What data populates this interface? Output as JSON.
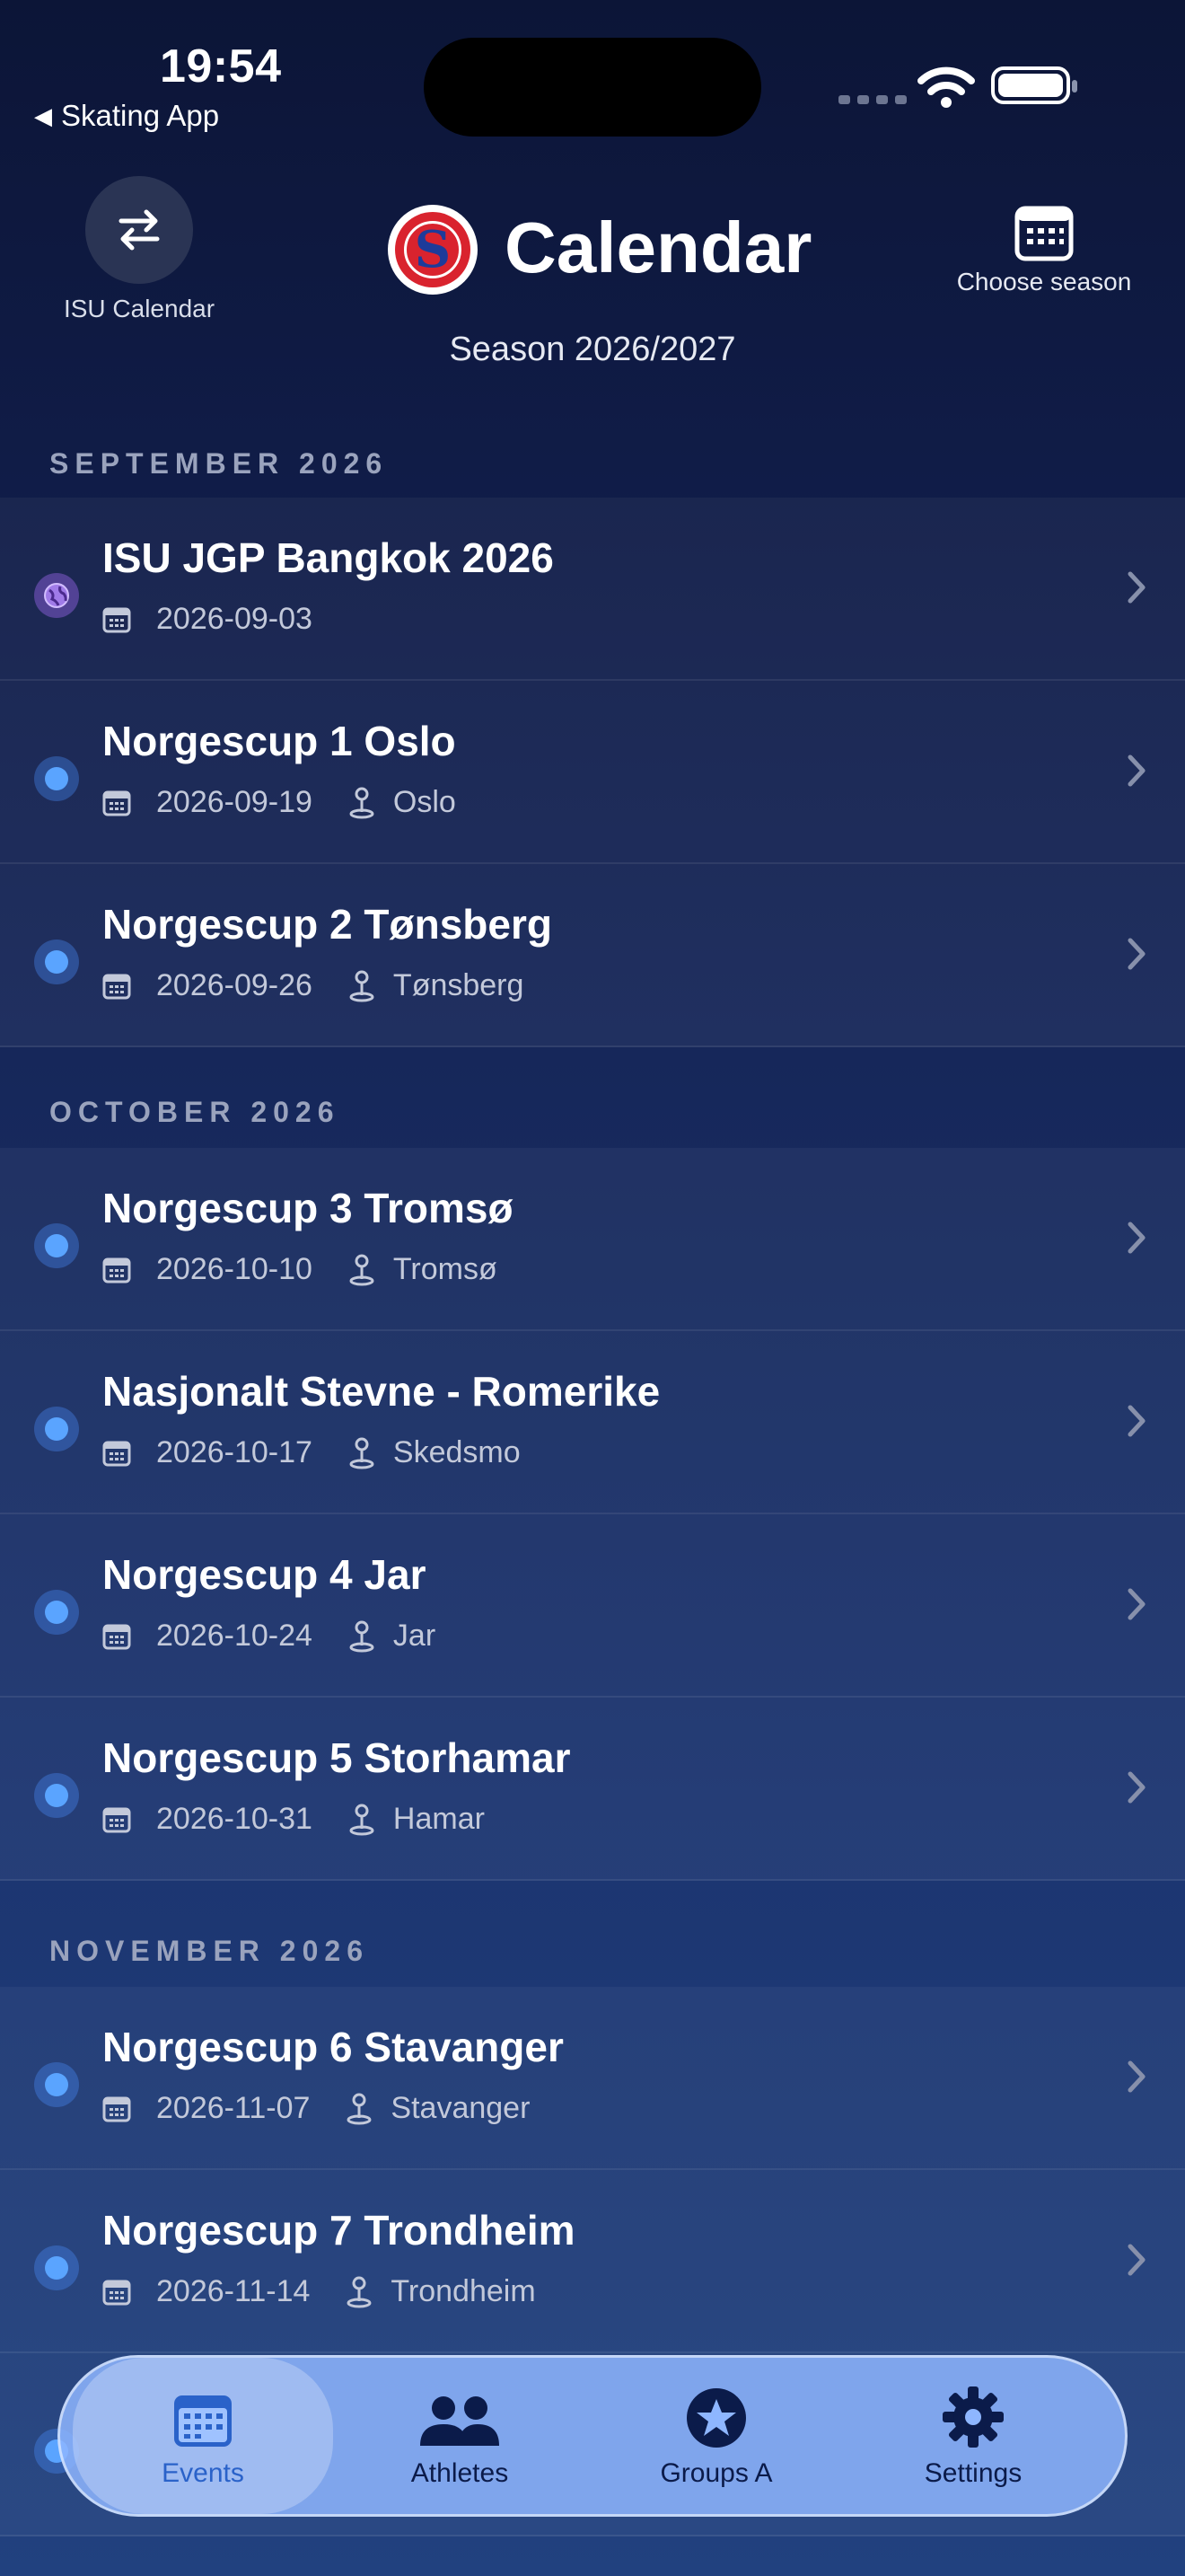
{
  "status_bar": {
    "time": "19:54",
    "back_app": "Skating App"
  },
  "header": {
    "isu_label": "ISU Calendar",
    "title": "Calendar",
    "season": "Season 2026/2027",
    "choose_season": "Choose season"
  },
  "sections": [
    {
      "title": "SEPTEMBER 2026",
      "events": [
        {
          "name": "ISU JGP Bangkok 2026",
          "date": "2026-09-03",
          "location": "",
          "kind": "international"
        },
        {
          "name": "Norgescup 1 Oslo",
          "date": "2026-09-19",
          "location": "Oslo",
          "kind": "national"
        },
        {
          "name": "Norgescup 2 Tønsberg",
          "date": "2026-09-26",
          "location": "Tønsberg",
          "kind": "national"
        }
      ]
    },
    {
      "title": "OCTOBER 2026",
      "events": [
        {
          "name": "Norgescup 3 Tromsø",
          "date": "2026-10-10",
          "location": "Tromsø",
          "kind": "national"
        },
        {
          "name": "Nasjonalt Stevne - Romerike",
          "date": "2026-10-17",
          "location": "Skedsmo",
          "kind": "national"
        },
        {
          "name": "Norgescup 4 Jar",
          "date": "2026-10-24",
          "location": "Jar",
          "kind": "national"
        },
        {
          "name": "Norgescup 5 Storhamar",
          "date": "2026-10-31",
          "location": "Hamar",
          "kind": "national"
        }
      ]
    },
    {
      "title": "NOVEMBER 2026",
      "events": [
        {
          "name": "Norgescup 6 Stavanger",
          "date": "2026-11-07",
          "location": "Stavanger",
          "kind": "national"
        },
        {
          "name": "Norgescup 7 Trondheim",
          "date": "2026-11-14",
          "location": "Trondheim",
          "kind": "national"
        }
      ]
    }
  ],
  "tabs": [
    {
      "label": "Events",
      "icon": "calendar-icon",
      "active": true
    },
    {
      "label": "Athletes",
      "icon": "people-icon",
      "active": false
    },
    {
      "label": "Groups A",
      "icon": "star-circle-icon",
      "active": false
    },
    {
      "label": "Settings",
      "icon": "gear-icon",
      "active": false
    }
  ],
  "colors": {
    "accent": "#5aa4ff",
    "tab_active": "#2a62c9",
    "tabbar": "#8eb6ff"
  }
}
